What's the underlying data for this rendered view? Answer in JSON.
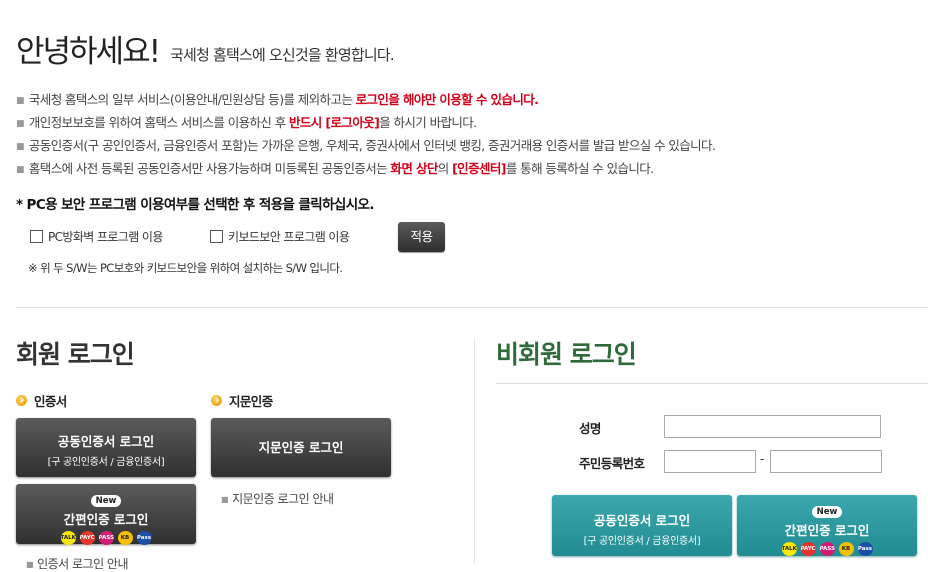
{
  "header": {
    "title": "안녕하세요!",
    "subtitle": "국세청 홈택스에 오신것을 환영합니다."
  },
  "notices": [
    {
      "pre": "국세청 홈택스의 일부 서비스(이용안내/민원상담 등)를 제외하고는 ",
      "em": "로그인을 해야만 이용할 수 있습니다.",
      "mid": "",
      "em2": "",
      "post": ""
    },
    {
      "pre": "개인정보보호를 위하여 홈택스 서비스를 이용하신 후 ",
      "em": "반드시 [로그아웃]",
      "mid": "을 하시기 바랍니다.",
      "em2": "",
      "post": ""
    },
    {
      "pre": "공동인증서(구 공인인증서, 금융인증서 포함)는 가까운 은행, 우체국, 증권사에서 인터넷 뱅킹, 증권거래용 인증서를 발급 받으실 수 있습니다.",
      "em": "",
      "mid": "",
      "em2": "",
      "post": ""
    },
    {
      "pre": "홈택스에 사전 등록된 공동인증서만 사용가능하며 미등록된 공동인증서는 ",
      "em": "화면 상단",
      "mid": "의 ",
      "em2": "[인증센터]",
      "post": "를 통해 등록하실 수 있습니다."
    }
  ],
  "security": {
    "title": "* PC용 보안 프로그램 이용여부를 선택한 후 적용을 클릭하십시오.",
    "option_firewall": "PC방화벽 프로그램 이용",
    "option_keyboard": "키보드보안 프로그램 이용",
    "apply_label": "적용",
    "note": "※ 위 두 S/W는 PC보호와 키보드보안을 위하여 설치하는 S/W 입니다."
  },
  "member": {
    "title": "회원 로그인",
    "cert_heading": "인증서",
    "bio_heading": "지문인증",
    "cert_login": {
      "main": "공동인증서 로그인",
      "sub": "[구 공인인증서 / 금융인증서]"
    },
    "simple_login": {
      "badge": "New",
      "main": "간편인증 로그인"
    },
    "bio_login": "지문인증 로그인",
    "bio_guide": "지문인증 로그인 안내",
    "cert_guide": "인증서 로그인 안내"
  },
  "guest": {
    "title": "비회원 로그인",
    "name_label": "성명",
    "rrn_label": "주민등록번호",
    "rrn_separator": "-",
    "cert_login": {
      "main": "공동인증서 로그인",
      "sub": "[구 공인인증서 / 금융인증서]"
    },
    "simple_login": {
      "badge": "New",
      "main": "간편인증 로그인"
    }
  },
  "auth_icons": [
    {
      "name": "kakao",
      "label": "TALK",
      "color": "#f7e600"
    },
    {
      "name": "payco",
      "label": "PAYCO",
      "color": "#e8342f"
    },
    {
      "name": "pass",
      "label": "PASS",
      "color": "#d41c73"
    },
    {
      "name": "kb",
      "label": "KB",
      "color": "#f5c000"
    },
    {
      "name": "samsung-pass",
      "label": "Pass",
      "color": "#1c4fa8"
    }
  ]
}
